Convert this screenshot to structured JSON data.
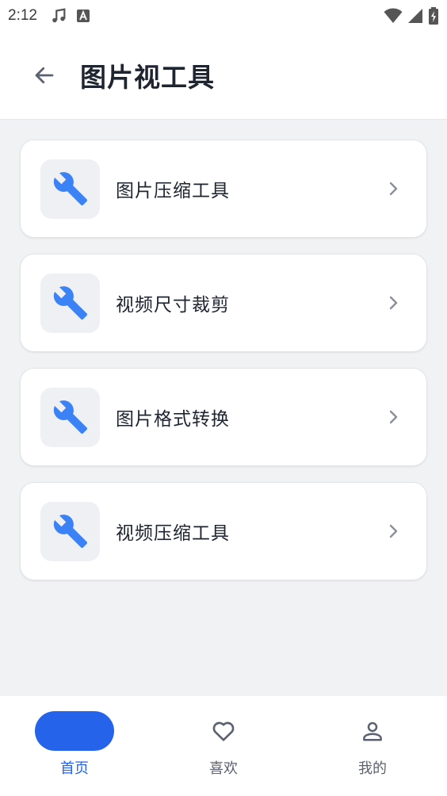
{
  "status_bar": {
    "time": "2:12",
    "icons_left": [
      "music-note-icon",
      "accessibility-a-icon"
    ],
    "icons_right": [
      "wifi-icon",
      "signal-icon",
      "battery-charging-icon"
    ]
  },
  "app_bar": {
    "back_icon": "arrow-left-icon",
    "title": "图片视工具"
  },
  "tools": [
    {
      "label": "图片压缩工具",
      "icon": "wrench-icon"
    },
    {
      "label": "视频尺寸裁剪",
      "icon": "wrench-icon"
    },
    {
      "label": "图片格式转换",
      "icon": "wrench-icon"
    },
    {
      "label": "视频压缩工具",
      "icon": "wrench-icon"
    }
  ],
  "bottom_nav": {
    "items": [
      {
        "label": "首页",
        "icon": "home-indicator",
        "active": true
      },
      {
        "label": "喜欢",
        "icon": "heart-icon",
        "active": false
      },
      {
        "label": "我的",
        "icon": "person-icon",
        "active": false
      }
    ]
  },
  "colors": {
    "accent": "#2563eb",
    "icon_blue": "#3b82f6",
    "background": "#f1f2f4",
    "card": "#ffffff",
    "text": "#1e2430",
    "muted": "#5b6170"
  }
}
